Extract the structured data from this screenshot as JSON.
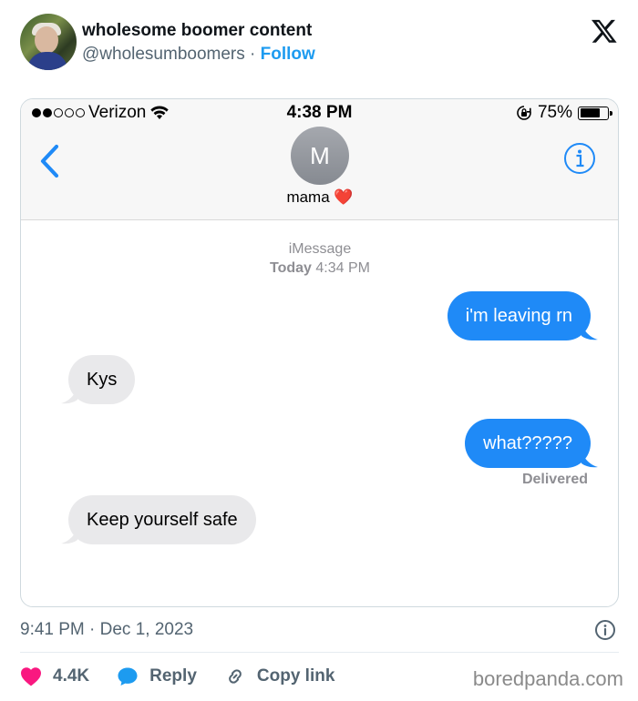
{
  "tweet": {
    "author_name": "wholesome boomer content",
    "author_handle": "@wholesumboomers",
    "separator": " · ",
    "follow_label": "Follow",
    "timestamp": "9:41 PM · Dec 1, 2023",
    "likes": "4.4K",
    "reply_label": "Reply",
    "copy_link_label": "Copy link",
    "watermark": "boredpanda.com"
  },
  "phone": {
    "status_bar": {
      "carrier": "Verizon",
      "time": "4:38 PM",
      "battery": "75%",
      "battery_level": 0.75,
      "signal_bars_filled": 2,
      "signal_bars_total": 5
    },
    "contact": {
      "initial": "M",
      "name": "mama ❤️"
    },
    "thread": {
      "service": "iMessage",
      "date_label": "Today",
      "date_time": "4:34 PM",
      "delivered_label": "Delivered",
      "messages": [
        {
          "direction": "out",
          "text": "i'm leaving rn"
        },
        {
          "direction": "in",
          "text": "Kys"
        },
        {
          "direction": "out",
          "text": "what?????"
        },
        {
          "direction": "in",
          "text": "Keep yourself safe"
        }
      ]
    }
  },
  "colors": {
    "outgoing_bubble": "#1f8af7",
    "incoming_bubble": "#e9e9eb",
    "follow_link": "#1d9bf0",
    "like_heart": "#f91880",
    "ios_blue": "#1f8af7"
  },
  "icons": {
    "x_logo": "x-logo-icon",
    "back": "chevron-left-icon",
    "info": "info-icon",
    "heart": "heart-icon",
    "reply": "reply-bubble-icon",
    "link": "link-icon",
    "wifi": "wifi-icon",
    "orientation_lock": "orientation-lock-icon",
    "battery": "battery-icon"
  }
}
